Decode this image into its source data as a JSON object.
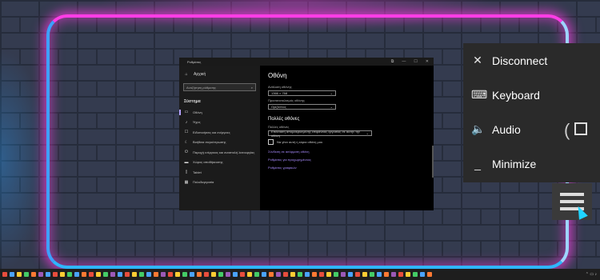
{
  "settings_window": {
    "title": "Ρυθμίσεις",
    "controls": [
      "⧉",
      "—",
      "☐",
      "✕"
    ],
    "sidebar": {
      "home": "Αρχική",
      "search_placeholder": "Αναζήτηση ρύθμισης",
      "group": "Σύστημα",
      "items": [
        {
          "icon": "monitor-icon",
          "glyph": "▭",
          "label": "Οθόνη",
          "active": true
        },
        {
          "icon": "sound-icon",
          "glyph": "♪",
          "label": "Ήχος"
        },
        {
          "icon": "notifications-icon",
          "glyph": "☐",
          "label": "Ειδοποιήσεις και ενέργειες"
        },
        {
          "icon": "focus-assist-icon",
          "glyph": "☾",
          "label": "Βοήθεια συγκέντρωσης"
        },
        {
          "icon": "power-icon",
          "glyph": "⏻",
          "label": "Παροχή ενέργειας και αναστολή λειτουργίας"
        },
        {
          "icon": "storage-icon",
          "glyph": "▬",
          "label": "Χώρος αποθήκευσης"
        },
        {
          "icon": "tablet-icon",
          "glyph": "▯",
          "label": "Tablet"
        },
        {
          "icon": "multitasking-icon",
          "glyph": "▦",
          "label": "Πολυδιεργασία"
        }
      ]
    },
    "main": {
      "title": "Οθόνη",
      "resolution_label": "Ανάλυση οθόνης",
      "resolution_value": "1366 × 768",
      "orientation_label": "Προσανατολισμός οθόνης",
      "orientation_value": "Οριζόντιος",
      "multi_heading": "Πολλές οθόνες",
      "multi_label": "Πολλές οθόνες",
      "multi_value": "Επέκταση απομακρυσμένης επιφάνειας εργασίας σε αυτήν την οθόνη",
      "checkbox_label": "Να γίνει αυτή η κύρια οθόνη μου",
      "links": [
        "Σύνδεση σε ασύρματη οθόνη",
        "Ρυθμίσεις για προχωρημένους",
        "Ρυθμίσεις γραφικών"
      ]
    }
  },
  "remote_menu": {
    "items": [
      {
        "icon": "close-icon",
        "glyph": "✕",
        "label": "Disconnect"
      },
      {
        "icon": "keyboard-icon",
        "glyph": "⌨",
        "label": "Keyboard"
      },
      {
        "icon": "speaker-icon",
        "glyph": "🔈",
        "label": "Audio"
      },
      {
        "icon": "minimize-icon",
        "glyph": "_",
        "label": "Minimize"
      }
    ],
    "hamburger_icon": "menu-icon"
  },
  "colors": {
    "neon_pink": "#ff3de6",
    "neon_blue": "#2fb6ff",
    "accent": "#a98cff",
    "menu_bg": "#2a2a2a"
  },
  "taskbar": {
    "icon_colors": [
      "#e84d3d",
      "#4aa3ff",
      "#ffcc33",
      "#44cc66",
      "#ff7a33",
      "#9b59b6",
      "#4aa3ff",
      "#e84d3d",
      "#ffcc33",
      "#44cc66",
      "#4aa3ff",
      "#ff7a33",
      "#e84d3d",
      "#ffcc33",
      "#44cc66",
      "#9b59b6",
      "#4aa3ff",
      "#e84d3d",
      "#ffcc33",
      "#44cc66",
      "#4aa3ff",
      "#ff7a33",
      "#9b59b6",
      "#e84d3d",
      "#ffcc33",
      "#44cc66",
      "#4aa3ff",
      "#ff7a33",
      "#e84d3d",
      "#ffcc33",
      "#44cc66",
      "#9b59b6",
      "#4aa3ff",
      "#e84d3d",
      "#ffcc33",
      "#44cc66",
      "#4aa3ff",
      "#ff7a33",
      "#9b59b6",
      "#e84d3d",
      "#ffcc33",
      "#44cc66",
      "#4aa3ff",
      "#ff7a33",
      "#e84d3d",
      "#ffcc33",
      "#44cc66",
      "#9b59b6",
      "#4aa3ff",
      "#e84d3d",
      "#ffcc33",
      "#44cc66",
      "#4aa3ff",
      "#ff7a33",
      "#9b59b6",
      "#e84d3d",
      "#ffcc33",
      "#44cc66",
      "#4aa3ff",
      "#ff7a33"
    ]
  }
}
